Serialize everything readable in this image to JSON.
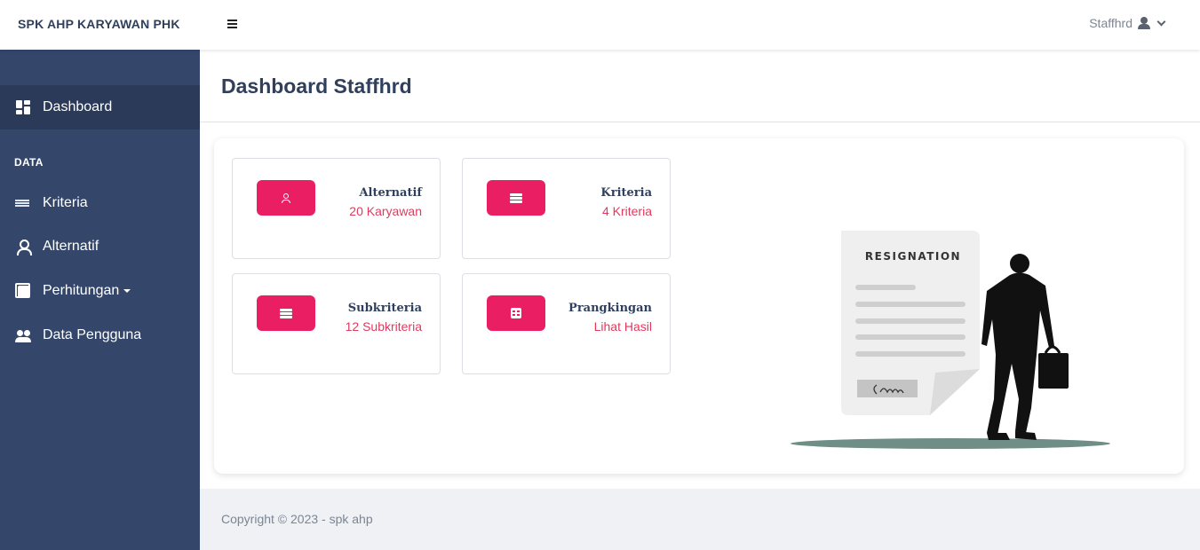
{
  "app": {
    "brand": "SPK AHP KARYAWAN PHK"
  },
  "topbar": {
    "user_name": "Staffhrd",
    "icons": [
      "menu-icon",
      "user-icon",
      "chevron-down-icon"
    ]
  },
  "sidebar": {
    "section_heading": "DATA",
    "items": [
      {
        "label": "Dashboard",
        "icon": "dashboard-icon",
        "active": true
      },
      {
        "label": "Kriteria",
        "icon": "list-icon"
      },
      {
        "label": "Alternatif",
        "icon": "person-icon"
      },
      {
        "label": "Perhitungan",
        "icon": "calculator-icon",
        "has_dropdown": true
      },
      {
        "label": "Data Pengguna",
        "icon": "users-icon"
      }
    ]
  },
  "page": {
    "title": "Dashboard Staffhrd"
  },
  "cards": [
    {
      "title": "Alternatif",
      "subtitle": "20 Karyawan",
      "icon": "person-icon"
    },
    {
      "title": "Kriteria",
      "subtitle": "4 Kriteria",
      "icon": "list-icon"
    },
    {
      "title": "Subkriteria",
      "subtitle": "12 Subkriteria",
      "icon": "list-icon"
    },
    {
      "title": "Prangkingan",
      "subtitle": "Lihat Hasil",
      "icon": "calculator-icon"
    }
  ],
  "illustration": {
    "document_heading": "RESIGNATION"
  },
  "footer": {
    "copyright": "Copyright © 2023 - spk ahp"
  },
  "colors": {
    "sidebar": "#34476b",
    "accent": "#e91e63",
    "title": "#2f3f5c"
  }
}
